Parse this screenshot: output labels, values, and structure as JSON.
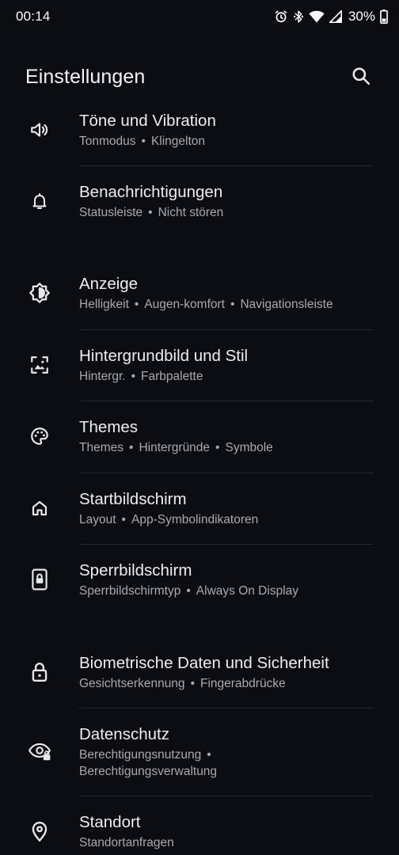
{
  "status_bar": {
    "time": "00:14",
    "battery": "30%",
    "icons": [
      "alarm-icon",
      "bluetooth-icon",
      "wifi-icon",
      "signal-icon",
      "battery-icon"
    ]
  },
  "header": {
    "title": "Einstellungen",
    "search_icon": "search-icon"
  },
  "items": [
    {
      "icon": "volume-icon",
      "title": "Töne und Vibration",
      "subtitles": [
        "Tonmodus",
        "Klingelton"
      ]
    },
    {
      "icon": "bell-icon",
      "title": "Benachrichtigungen",
      "subtitles": [
        "Statusleiste",
        "Nicht stören"
      ]
    },
    {
      "icon": "brightness-icon",
      "title": "Anzeige",
      "subtitles": [
        "Helligkeit",
        "Augen-komfort",
        "Navigationsleiste"
      ]
    },
    {
      "icon": "wallpaper-icon",
      "title": "Hintergrundbild und Stil",
      "subtitles": [
        "Hintergr.",
        "Farbpalette"
      ]
    },
    {
      "icon": "palette-icon",
      "title": "Themes",
      "subtitles": [
        "Themes",
        "Hintergründe",
        "Symbole"
      ]
    },
    {
      "icon": "home-icon",
      "title": "Startbildschirm",
      "subtitles": [
        "Layout",
        "App-Symbolindikatoren"
      ]
    },
    {
      "icon": "lockscreen-icon",
      "title": "Sperrbildschirm",
      "subtitles": [
        "Sperrbildschirmtyp",
        "Always On Display"
      ]
    },
    {
      "icon": "lock-icon",
      "title": "Biometrische Daten und Sicherheit",
      "subtitles": [
        "Gesichtserkennung",
        "Fingerabdrücke"
      ]
    },
    {
      "icon": "privacy-eye-icon",
      "title": "Datenschutz",
      "subtitles": [
        "Berechtigungsnutzung",
        "Berechtigungsverwaltung"
      ]
    },
    {
      "icon": "location-icon",
      "title": "Standort",
      "subtitles": [
        "Standortanfragen"
      ]
    }
  ]
}
